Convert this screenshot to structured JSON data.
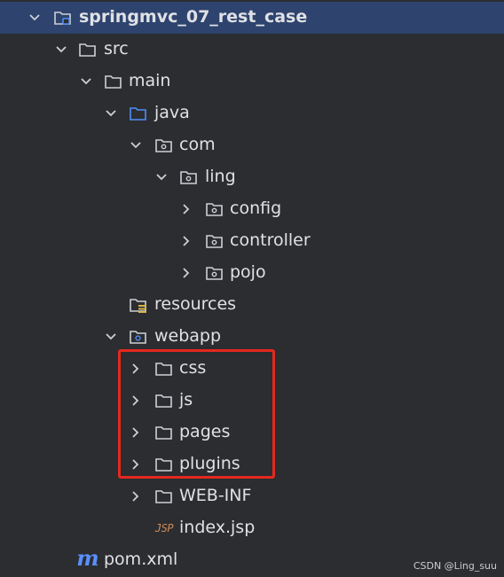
{
  "project": {
    "name": "springmvc_07_rest_case"
  },
  "tree": {
    "src": "src",
    "main": "main",
    "java": "java",
    "com": "com",
    "ling": "ling",
    "config": "config",
    "controller": "controller",
    "pojo": "pojo",
    "resources": "resources",
    "webapp": "webapp",
    "css": "css",
    "js": "js",
    "pages": "pages",
    "plugins": "plugins",
    "web_inf": "WEB-INF",
    "index_jsp": "index.jsp",
    "pom_xml": "pom.xml"
  },
  "icons": {
    "pom_glyph": "m",
    "jsp_glyph": "JSP"
  },
  "colors": {
    "background": "#2b2d30",
    "selection": "#2e436e",
    "highlight_border": "#e5281f",
    "java_folder": "#4f8ef7"
  },
  "watermark": "CSDN @Ling_suu"
}
